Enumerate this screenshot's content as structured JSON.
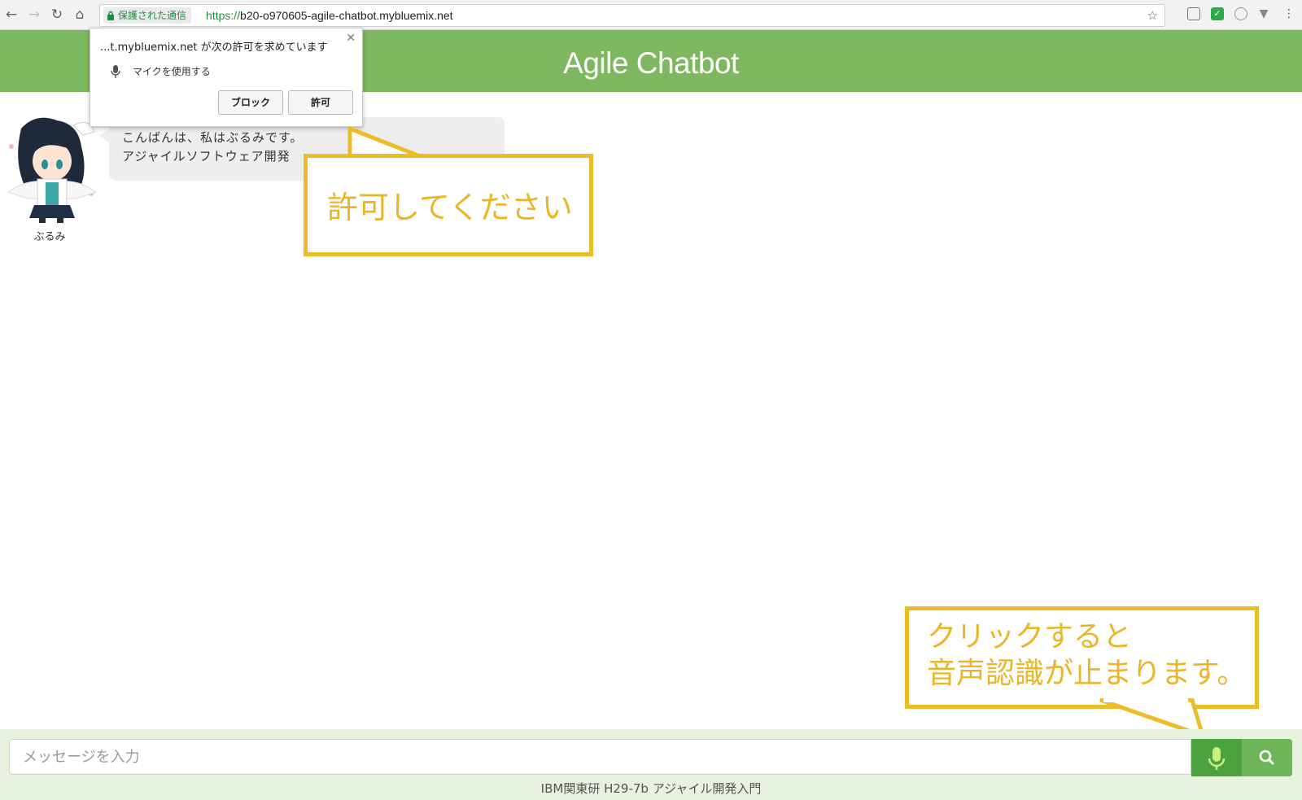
{
  "browser": {
    "secure_label": "保護された通信",
    "url_scheme": "https://",
    "url_rest": "b20-o970605-agile-chatbot.mybluemix.net"
  },
  "permission_dialog": {
    "title": "...t.mybluemix.net が次の許可を求めています",
    "permission": "マイクを使用する",
    "block_label": "ブロック",
    "allow_label": "許可"
  },
  "header": {
    "title": "Agile Chatbot"
  },
  "chat": {
    "bot_name": "ぶるみ",
    "message": "こんばんは、私はぶるみです。\nアジャイルソフトウェア開発"
  },
  "annotations": {
    "allow_hint": "許可してください",
    "mic_hint": "クリックすると\n音声認識が止まります。"
  },
  "input": {
    "placeholder": "メッセージを入力"
  },
  "footer": {
    "text": "IBM関東研 H29-7b アジャイル開発入門"
  },
  "icons": {
    "back": "arrow-left-icon",
    "forward": "arrow-right-icon",
    "reload": "reload-icon",
    "home": "home-icon",
    "lock": "lock-icon",
    "star": "star-icon",
    "mic": "microphone-icon",
    "search": "search-icon"
  },
  "colors": {
    "header": "#7db75f",
    "callout": "#ecbd2a",
    "mic_button": "#4ca23f",
    "search_button": "#6fb65a",
    "bottom_bar": "#e7f2df"
  }
}
